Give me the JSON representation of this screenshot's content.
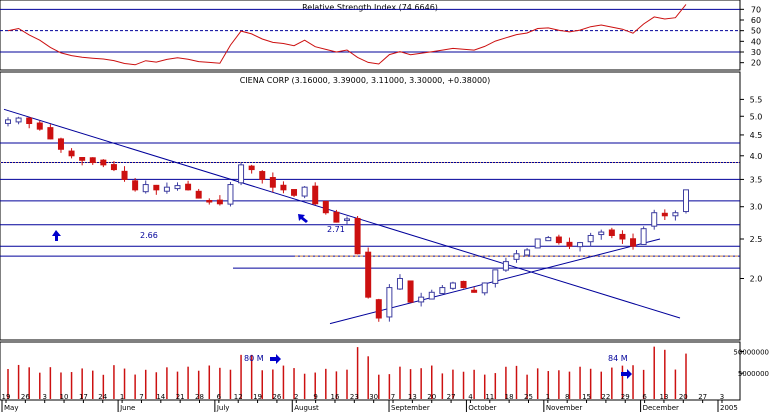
{
  "colors": {
    "up": "#3e3ea0",
    "down": "#cc1010",
    "line": "#00009a",
    "rsi": "#cc1010",
    "dashed_guide": "#f0a850",
    "dotted_guide": "#d8a070",
    "arrow": "#0000cc",
    "frame": "#000000"
  },
  "rsi_panel": {
    "title": "Relative Strength Index (74.6646)",
    "ticks": [
      {
        "v": 70,
        "t": "70"
      },
      {
        "v": 60,
        "t": "60"
      },
      {
        "v": 50,
        "t": "50"
      },
      {
        "v": 40,
        "t": "40"
      },
      {
        "v": 30,
        "t": "30"
      },
      {
        "v": 20,
        "t": "20"
      }
    ]
  },
  "price_panel": {
    "title": "CIENA CORP (3.16000, 3.39000, 3.11000, 3.30000, +0.38000)",
    "ticks": [
      {
        "v": 5.5,
        "t": "5.5"
      },
      {
        "v": 5.0,
        "t": "5.0"
      },
      {
        "v": 4.5,
        "t": "4.5"
      },
      {
        "v": 4.0,
        "t": "4.0"
      },
      {
        "v": 3.5,
        "t": "3.5"
      },
      {
        "v": 3.0,
        "t": "3.0"
      },
      {
        "v": 2.5,
        "t": "2.5"
      },
      {
        "v": 2.0,
        "t": "2.0"
      }
    ],
    "annotations": [
      {
        "id": "label-2-66",
        "text": "2.66"
      },
      {
        "id": "label-2-71",
        "text": "2.71"
      }
    ]
  },
  "volume_panel": {
    "ticks": [
      {
        "v": 50000000,
        "t": "50000000"
      },
      {
        "v": 5000000,
        "t": "5000000"
      }
    ],
    "annotations": [
      {
        "id": "label-80m",
        "text": "80 M"
      },
      {
        "id": "label-84m",
        "text": "84 M"
      }
    ]
  },
  "x_axis": {
    "day_labels": [
      "19",
      "26",
      "3",
      "10",
      "17",
      "24",
      "1",
      "7",
      "14",
      "21",
      "28",
      "6",
      "12",
      "19",
      "26",
      "2",
      "9",
      "16",
      "23",
      "30",
      "7",
      "13",
      "20",
      "27",
      "4",
      "11",
      "18",
      "25",
      "1",
      "8",
      "15",
      "22",
      "29",
      "6",
      "13",
      "20",
      "27",
      "3"
    ],
    "month_labels": [
      "May",
      "June",
      "July",
      "August",
      "September",
      "October",
      "November",
      "December",
      "2005"
    ]
  },
  "chart_data": {
    "type": "candlestick",
    "title": "CIENA CORP (3.16000, 3.39000, 3.11000, 3.30000, +0.38000)",
    "symbol": "CIENA CORP",
    "last_bar": {
      "open": 3.16,
      "high": 3.39,
      "low": 3.11,
      "close": 3.3,
      "change": 0.38
    },
    "price_axis_range": [
      1.6,
      5.8
    ],
    "price_scale": "log",
    "rsi_axis_range": [
      15,
      75
    ],
    "rsi_levels": [
      70,
      50,
      30
    ],
    "volume_scale": "log",
    "closes_approx": [
      4.9,
      4.95,
      4.8,
      4.65,
      4.4,
      4.15,
      4.0,
      3.9,
      3.85,
      3.8,
      3.7,
      3.5,
      3.3,
      3.4,
      3.3,
      3.35,
      3.38,
      3.3,
      3.15,
      3.1,
      3.05,
      3.4,
      3.8,
      3.7,
      3.5,
      3.35,
      3.3,
      3.2,
      3.35,
      3.05,
      2.9,
      2.75,
      2.8,
      2.3,
      1.8,
      1.6,
      1.9,
      2.0,
      1.75,
      1.8,
      1.85,
      1.9,
      1.95,
      1.9,
      1.85,
      1.95,
      2.1,
      2.2,
      2.3,
      2.35,
      2.5,
      2.52,
      2.45,
      2.4,
      2.45,
      2.55,
      2.6,
      2.55,
      2.5,
      2.4,
      2.65,
      2.9,
      2.85,
      2.9,
      3.3
    ],
    "trendlines": [
      {
        "name": "descending resistance",
        "from": [
          "May 19",
          5.2
        ],
        "to": [
          "Dec 27",
          1.6
        ]
      },
      {
        "name": "ascending support",
        "from": [
          "Aug 16",
          1.55
        ],
        "to": [
          "Dec 13",
          2.5
        ]
      }
    ],
    "horizontal_levels": [
      4.3,
      3.85,
      3.5,
      3.1,
      2.71,
      2.4,
      2.27,
      2.12
    ],
    "annotations": [
      "2.66",
      "2.71",
      "80 M",
      "84 M"
    ]
  }
}
